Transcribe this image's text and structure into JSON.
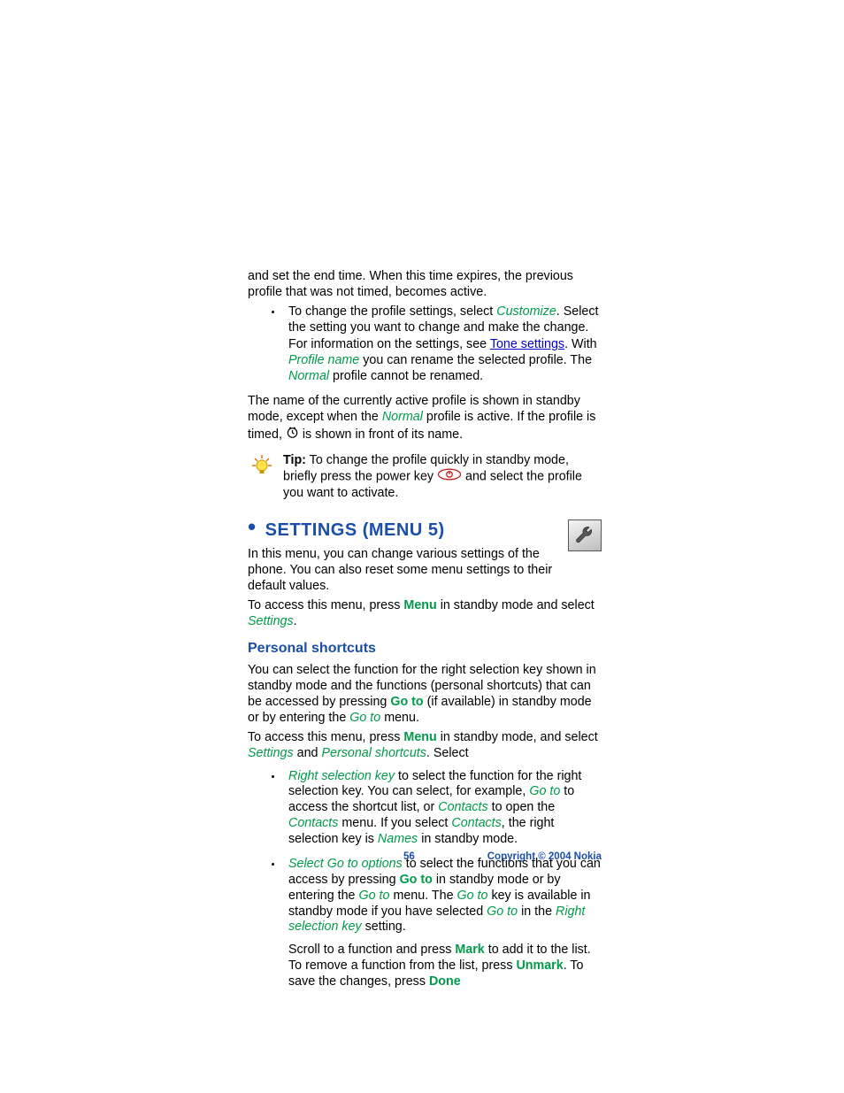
{
  "top_list": {
    "cont_prev": "and set the end time. When this time expires, the previous profile that was not timed, becomes active.",
    "li2_a": "To change the profile settings, select ",
    "li2_cust": "Customize",
    "li2_b": ". Select the setting you want to change and make the change.",
    "li2_c": "For information on the settings, see ",
    "li2_link": "Tone settings",
    "li2_d": ". With ",
    "li2_pn": "Profile name",
    "li2_e": " you can rename the selected profile. The ",
    "li2_norm": "Normal",
    "li2_f": " profile cannot be renamed."
  },
  "standby": {
    "a": "The name of the currently active profile is shown in standby mode, except when the ",
    "norm": "Normal",
    "b": " profile is active. If the profile is timed, ",
    "c": " is shown in front of its name."
  },
  "tip": {
    "label": "Tip:",
    "a": " To change the profile quickly in standby mode, briefly press the power key ",
    "b": " and select the profile you want to activate."
  },
  "section_title": "SETTINGS (MENU 5)",
  "section_intro": "In this menu, you can change various settings of the phone. You can also reset some menu settings to their default values.",
  "section_access_a": "To access this menu, press ",
  "section_access_menu": "Menu",
  "section_access_b": " in standby mode and select ",
  "section_access_set": "Settings",
  "section_access_c": ".",
  "sub_title": "Personal shortcuts",
  "sub_para": {
    "a": "You can select the function for the right selection key shown in standby mode and the functions (personal shortcuts) that can be accessed by pressing ",
    "goto": "Go to",
    "b": " (if available) in standby mode or by entering the ",
    "goto2": "Go to",
    "c": " menu."
  },
  "sub_access": {
    "a": "To access this menu, press ",
    "menu": "Menu",
    "b": " in standby mode, and select ",
    "set": "Settings",
    "c": " and ",
    "ps": "Personal shortcuts",
    "d": ". Select"
  },
  "bl": {
    "i1_head": "Right selection key",
    "i1_a": " to select the function for the right selection key. You can select, for example, ",
    "i1_goto": "Go to",
    "i1_b": " to access the shortcut list, or ",
    "i1_ct1": "Contacts",
    "i1_c": " to open the ",
    "i1_ct2": "Contacts",
    "i1_d": " menu. If you select ",
    "i1_ct3": "Contacts",
    "i1_e": ", the right selection key is ",
    "i1_names": "Names",
    "i1_f": " in standby mode.",
    "i2_head": "Select Go to options",
    "i2_a": " to select the functions that you can access by pressing ",
    "i2_goto1": "Go to",
    "i2_b": " in standby mode or by entering the ",
    "i2_goto2": "Go to",
    "i2_c": " menu. The ",
    "i2_goto3": "Go to",
    "i2_d": " key is available in standby mode if you have selected ",
    "i2_goto4": "Go to",
    "i2_e": " in the ",
    "i2_rsk": "Right selection key",
    "i2_f": " setting.",
    "i2_p2a": "Scroll to a function and press ",
    "i2_mark": "Mark",
    "i2_p2b": " to add it to the list. To remove a function from the list, press ",
    "i2_unmark": "Unmark",
    "i2_p2c": ". To save the changes, press ",
    "i2_done": "Done"
  },
  "footer": {
    "page": "56",
    "copyright": "Copyright © 2004 Nokia"
  }
}
